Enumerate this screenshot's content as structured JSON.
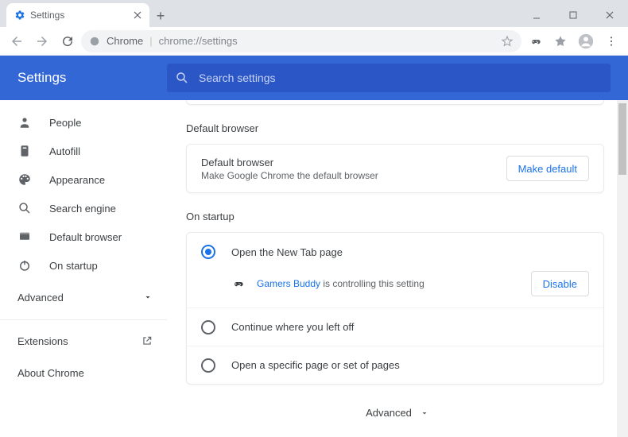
{
  "window": {
    "tab_title": "Settings",
    "newtab_glyph": "+"
  },
  "omnibox": {
    "host": "Chrome",
    "path": "chrome://settings"
  },
  "header": {
    "title": "Settings",
    "search_placeholder": "Search settings"
  },
  "sidebar": {
    "items": [
      {
        "label": "People"
      },
      {
        "label": "Autofill"
      },
      {
        "label": "Appearance"
      },
      {
        "label": "Search engine"
      },
      {
        "label": "Default browser"
      },
      {
        "label": "On startup"
      }
    ],
    "advanced": "Advanced",
    "extensions": "Extensions",
    "about": "About Chrome"
  },
  "sections": {
    "default_browser": {
      "title": "Default browser",
      "row_title": "Default browser",
      "row_desc": "Make Google Chrome the default browser",
      "button": "Make default"
    },
    "on_startup": {
      "title": "On startup",
      "opt_newtab": "Open the New Tab page",
      "controller_app": "Gamers Buddy",
      "controller_suffix": " is controlling this setting",
      "disable": "Disable",
      "opt_continue": "Continue where you left off",
      "opt_specific": "Open a specific page or set of pages"
    },
    "advanced_footer": "Advanced"
  }
}
